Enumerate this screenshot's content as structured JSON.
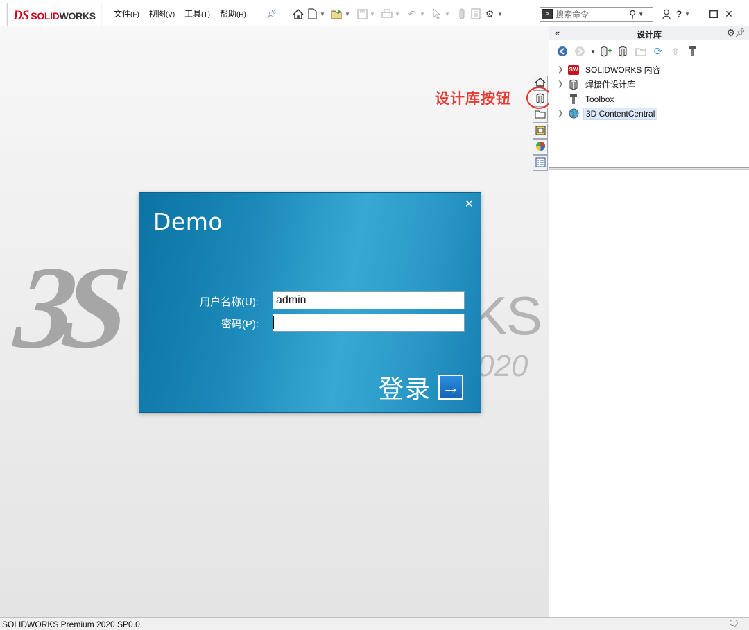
{
  "app": {
    "logo_ds": "DS",
    "logo_brand_a": "SOLID",
    "logo_brand_b": "WORKS"
  },
  "menu": [
    {
      "label": "文件",
      "key": "(F)"
    },
    {
      "label": "视图",
      "key": "(V)"
    },
    {
      "label": "工具",
      "key": "(T)"
    },
    {
      "label": "帮助",
      "key": "(H)"
    }
  ],
  "toolbar_icons": [
    "home-icon",
    "new-document-icon",
    "open-icon",
    "save-icon",
    "print-icon",
    "undo-icon",
    "select-icon",
    "rebuild-icon",
    "file-properties-icon",
    "options-icon"
  ],
  "command_search": {
    "placeholder": "搜索命令"
  },
  "background": {
    "logo_ds": "3S",
    "logo_ks": "KS",
    "logo_year": "020"
  },
  "annotation": {
    "text": "设计库按钮",
    "color": "#e53d35"
  },
  "task_pane": {
    "title": "设计库",
    "tree": [
      {
        "label": "SOLIDWORKS 内容",
        "expandable": true,
        "icon": "solidworks-content-icon"
      },
      {
        "label": "焊接件设计库",
        "expandable": true,
        "icon": "design-library-icon"
      },
      {
        "label": "Toolbox",
        "expandable": false,
        "icon": "toolbox-icon"
      },
      {
        "label": "3D ContentCentral",
        "expandable": true,
        "icon": "globe-icon",
        "selected": true
      }
    ]
  },
  "dialog": {
    "title": "Demo",
    "username_label": "用户名称(U):",
    "username_value": "admin",
    "password_label": "密码(P):",
    "password_value": "",
    "login_label": "登录",
    "accent_color": "#2a98c6"
  },
  "status": {
    "text": "SOLIDWORKS Premium 2020 SP0.0"
  }
}
